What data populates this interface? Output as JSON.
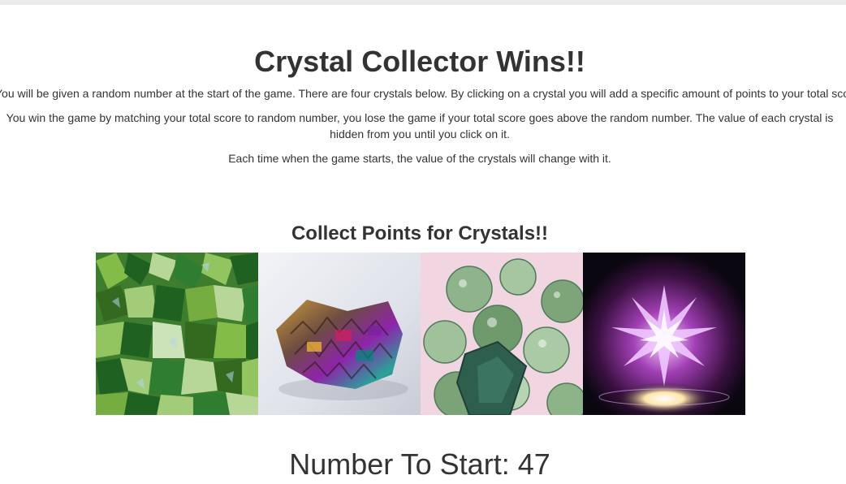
{
  "page": {
    "title": "Crystal Collector Wins!!",
    "intro_line_1": "You will be given a random number at the start of the game. There are four crystals below. By clicking on a crystal you will add a specific amount of points to your total score.",
    "intro_line_2": "You win the game by matching your total score to random number, you lose the game if your total score goes above the random number. The value of each crystal is hidden from you until you click on it.",
    "intro_line_3": "Each time when the game starts, the value of the crystals will change with it.",
    "subtitle": "Collect Points for Crystals!!",
    "number_to_start_label": "Number To Start: 47"
  },
  "crystals": [
    {
      "name": "green-crystal-cluster",
      "colors": [
        "#2e7d32",
        "#8bc34a",
        "#c5e1a5",
        "#1b5e20"
      ]
    },
    {
      "name": "bismuth-crystal",
      "colors": [
        "#e8eaf0",
        "#6d4c41",
        "#8e24aa",
        "#26a69a"
      ]
    },
    {
      "name": "green-faceted-beads",
      "colors": [
        "#f3d9e6",
        "#7fa87c",
        "#2e5e4e",
        "#c8e6c9"
      ]
    },
    {
      "name": "glowing-star-crystal",
      "colors": [
        "#0b0710",
        "#a13fb5",
        "#f8e1ff",
        "#ffffff"
      ]
    }
  ]
}
